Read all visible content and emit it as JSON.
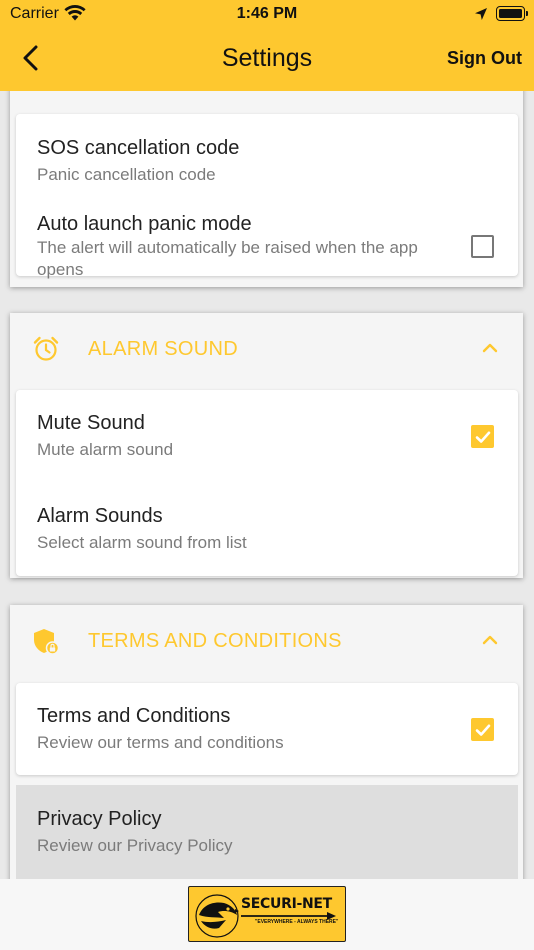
{
  "status_bar": {
    "carrier": "Carrier",
    "time": "1:46 PM"
  },
  "app_bar": {
    "title": "Settings",
    "sign_out": "Sign Out"
  },
  "panic_section": {
    "items": [
      {
        "title": "SOS cancellation code",
        "subtitle": "Panic cancellation code"
      },
      {
        "title": "Auto launch panic mode",
        "subtitle": "The alert will automatically be raised when the app opens",
        "checked": false
      }
    ]
  },
  "alarm_section": {
    "header": "ALARM SOUND",
    "icon": "alarm-clock-icon",
    "items": [
      {
        "title": "Mute Sound",
        "subtitle": "Mute alarm sound",
        "checked": true
      },
      {
        "title": "Alarm Sounds",
        "subtitle": "Select alarm sound from list"
      }
    ]
  },
  "terms_section": {
    "header": "TERMS AND CONDITIONS",
    "icon": "shield-lock-icon",
    "items": [
      {
        "title": "Terms and Conditions",
        "subtitle": "Review our terms and conditions",
        "checked": true
      },
      {
        "title": "Privacy Policy",
        "subtitle": "Review our Privacy Policy"
      }
    ]
  },
  "footer": {
    "logo_text": "SECURI-NET",
    "logo_tagline": "\"EVERYWHERE - ALWAYS THERE\""
  },
  "colors": {
    "accent": "#fec82f",
    "background": "#e9e9e9",
    "panel": "#f5f5f5"
  }
}
